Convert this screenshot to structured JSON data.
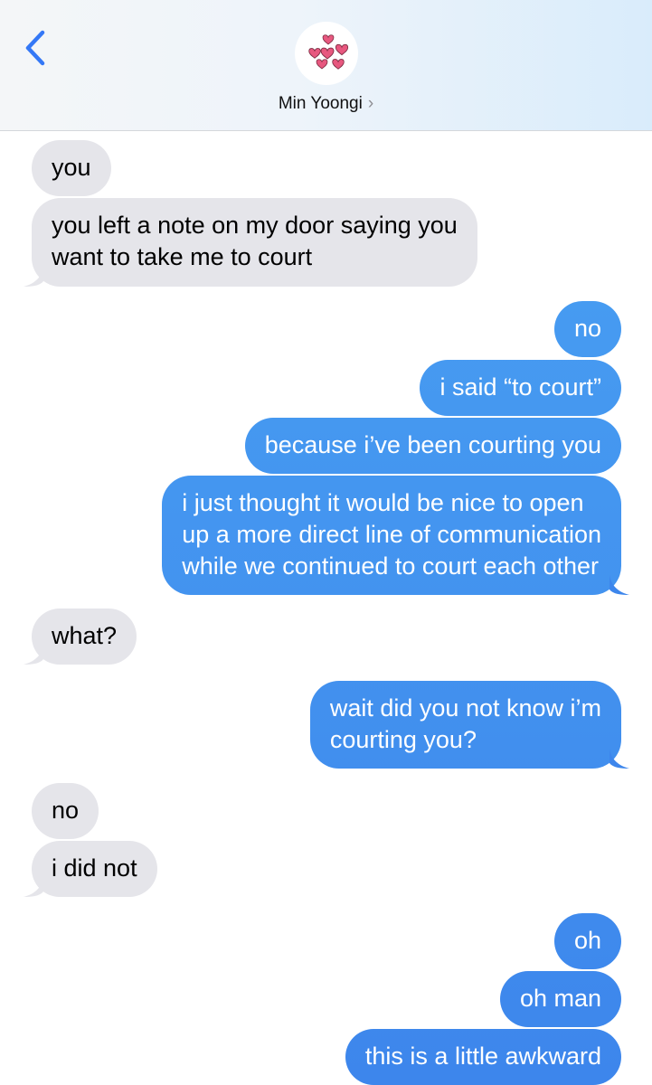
{
  "header": {
    "contact_name": "Min Yoongi",
    "chevron": "›",
    "back_icon": "chevron-left-icon",
    "avatar_icon": "hearts-icon",
    "accent_color": "#3478f6"
  },
  "colors": {
    "received_bubble": "#e5e5ea",
    "sent_bubble_light": "#4aa3f3",
    "sent_bubble_dark": "#3d86ec",
    "heart": "#e7587f"
  },
  "messages": [
    {
      "from": "them",
      "text": [
        "you"
      ]
    },
    {
      "from": "them",
      "text": [
        "you left a note on my door saying you",
        "want to take me to court"
      ]
    },
    {
      "from": "me",
      "text": [
        "no"
      ]
    },
    {
      "from": "me",
      "text": [
        "i said “to court”"
      ]
    },
    {
      "from": "me",
      "text": [
        "because i’ve been courting you"
      ]
    },
    {
      "from": "me",
      "text": [
        "i just thought it would be nice to open",
        "up a more direct line of communication",
        "while we continued to court each other"
      ]
    },
    {
      "from": "them",
      "text": [
        "what?"
      ]
    },
    {
      "from": "me",
      "text": [
        "wait did you not know i’m",
        "courting you?"
      ]
    },
    {
      "from": "them",
      "text": [
        "no"
      ]
    },
    {
      "from": "them",
      "text": [
        "i did not"
      ]
    },
    {
      "from": "me",
      "text": [
        "oh"
      ]
    },
    {
      "from": "me",
      "text": [
        "oh man"
      ]
    },
    {
      "from": "me",
      "text": [
        "this is a little awkward"
      ]
    }
  ]
}
